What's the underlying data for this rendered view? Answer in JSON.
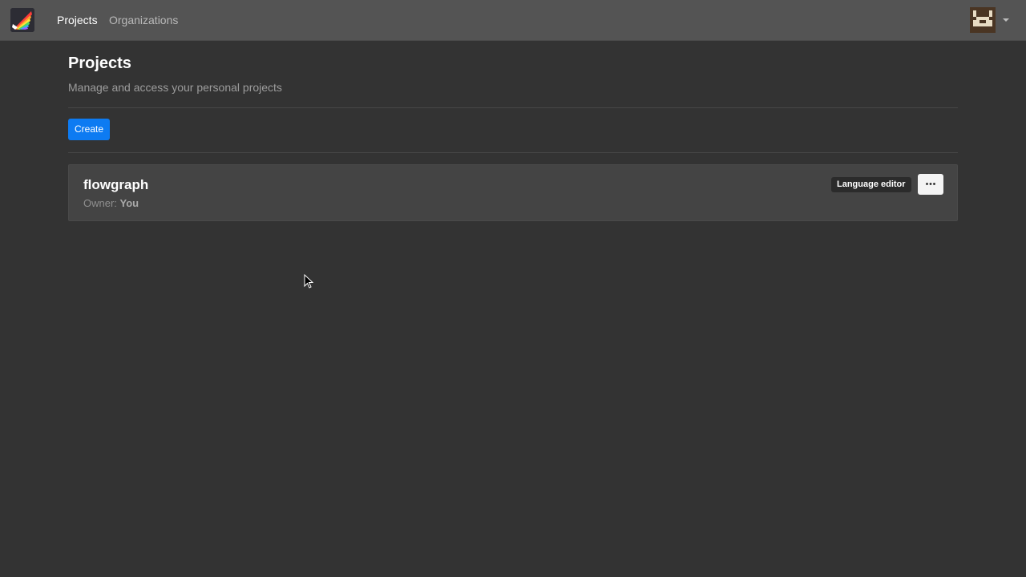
{
  "navbar": {
    "logo_icon": "rainbow-logo-icon",
    "links": [
      {
        "label": "Projects",
        "active": true
      },
      {
        "label": "Organizations",
        "active": false
      }
    ],
    "user_avatar_icon": "pixel-avatar-icon",
    "menu_caret_icon": "caret-down-icon"
  },
  "page": {
    "title": "Projects",
    "subtitle": "Manage and access your personal projects"
  },
  "toolbar": {
    "create_label": "Create"
  },
  "projects": [
    {
      "name": "flowgraph",
      "owner_label": "Owner:",
      "owner_value": "You",
      "badge": "Language editor",
      "more_icon": "ellipsis-icon"
    }
  ],
  "colors": {
    "background": "#333333",
    "navbar": "#545454",
    "card": "#444444",
    "primary": "#0d7bf2"
  }
}
